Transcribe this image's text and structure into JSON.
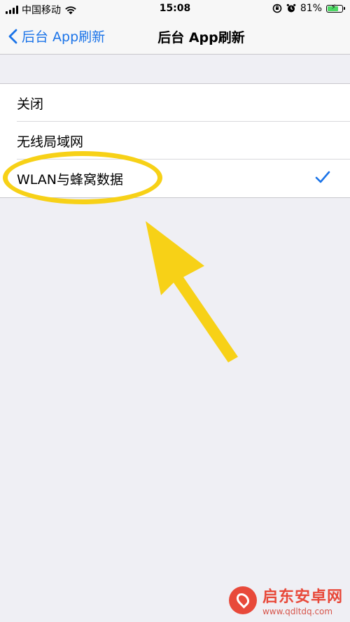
{
  "status_bar": {
    "carrier": "中国移动",
    "time": "15:08",
    "battery": "81%",
    "battery_level": 0.81
  },
  "nav": {
    "back_label": "后台 App刷新",
    "title": "后台 App刷新"
  },
  "options": [
    {
      "label": "关闭",
      "selected": false
    },
    {
      "label": "无线局域网",
      "selected": false
    },
    {
      "label": "WLAN与蜂窝数据",
      "selected": true
    }
  ],
  "colors": {
    "accent": "#1a73e8",
    "annotation": "#f7d117",
    "background": "#efeff4"
  },
  "watermark": {
    "name": "启东安卓网",
    "url": "www.qdltdq.com"
  }
}
